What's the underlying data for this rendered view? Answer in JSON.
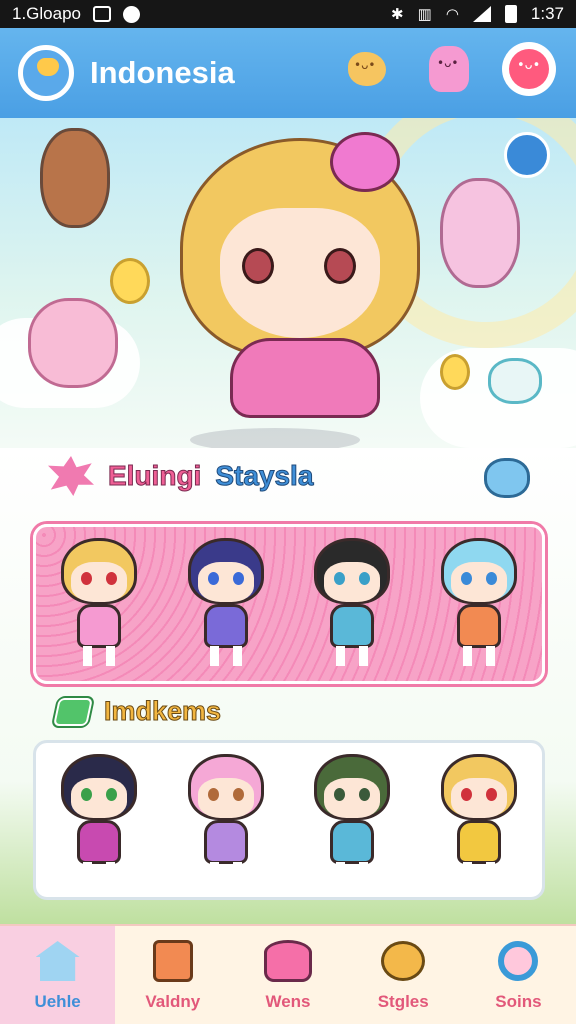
{
  "status_bar": {
    "time_left": "1.Gloapo",
    "time_right": "1:37"
  },
  "header": {
    "title": "Indonesia"
  },
  "section1": {
    "title_part1": "Eluingi",
    "title_part2": "Staysla"
  },
  "section2": {
    "title": "Imdkems"
  },
  "bottom_nav": {
    "items": [
      {
        "label": "Uehle"
      },
      {
        "label": "Valdny"
      },
      {
        "label": "Wens"
      },
      {
        "label": "Stgles"
      },
      {
        "label": "Soins"
      }
    ]
  },
  "colors": {
    "header": "#4a9fe4",
    "accent_pink": "#ef5f95",
    "accent_blue": "#3f8fd8",
    "nav_bg": "#fff4e4"
  }
}
